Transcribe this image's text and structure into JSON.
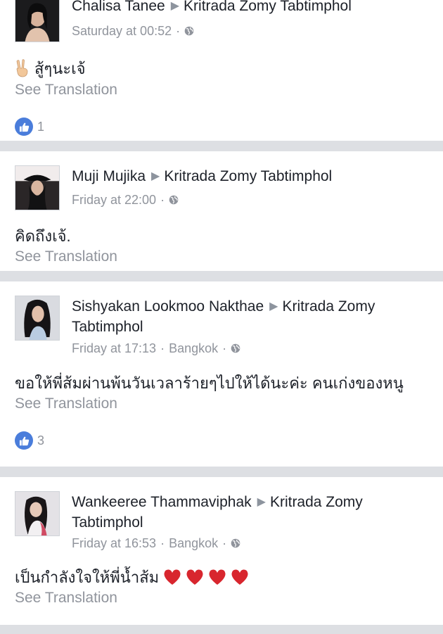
{
  "posts": [
    {
      "author": "Chalisa Tanee",
      "recipient": "Kritrada Zomy Tabtimphol",
      "time": "Saturday at 00:52",
      "location": "",
      "body": "สู้ๆนะเจ้",
      "see_translation": "See Translation",
      "likes": "1"
    },
    {
      "author": "Muji Mujika",
      "recipient": "Kritrada Zomy Tabtimphol",
      "time": "Friday at 22:00",
      "location": "",
      "body": "คิดถึงเจ้.",
      "see_translation": "See Translation",
      "likes": ""
    },
    {
      "author": "Sishyakan Lookmoo Nakthae",
      "recipient": "Kritrada Zomy Tabtimphol",
      "time": "Friday at 17:13",
      "location": "Bangkok",
      "body": "ขอให้พี่ส้มผ่านพ้นวันเวลาร้ายๆไปให้ได้นะค่ะ คนเก่งของหนู",
      "see_translation": "See Translation",
      "likes": "3"
    },
    {
      "author": "Wankeeree Thammaviphak",
      "recipient": "Kritrada Zomy Tabtimphol",
      "time": "Friday at 16:53",
      "location": "Bangkok",
      "body": "เป็นกำลังใจให้พี่น้ำส้ม",
      "see_translation": "See Translation",
      "likes": ""
    }
  ],
  "icons": {
    "privacy": "globe-icon",
    "like": "thumbs-up-icon",
    "victory": "victory-hand-icon",
    "heart": "red-heart-icon",
    "separator": "triangle-right-icon"
  },
  "colors": {
    "like_blue": "#4a7ddb",
    "meta_gray": "#90949c",
    "divider": "#dddfe3",
    "heart_red": "#d8262e"
  }
}
